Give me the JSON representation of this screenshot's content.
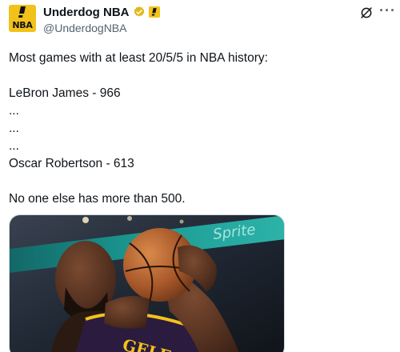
{
  "account": {
    "display_name": "Underdog NBA",
    "handle": "@UnderdogNBA",
    "avatar_text": "NBA",
    "verified_icon": "verified-badge-icon",
    "affiliate_icon": "underdog-affiliate-icon"
  },
  "header_actions": {
    "grok_icon": "grok-icon",
    "more_label": "···"
  },
  "tweet": {
    "lines": [
      "Most games with at least 20/5/5 in NBA history:",
      "",
      "LeBron James - 966",
      "...",
      "...",
      "...",
      "Oscar Robertson - 613",
      "",
      "No one else has more than 500."
    ]
  },
  "media": {
    "alt": "photo-lebron-james-basketball",
    "jersey_text": "GELES",
    "banner_text": "Sprite"
  },
  "colors": {
    "brand_yellow": "#f2c21b",
    "verified_gold": "#e2b719",
    "text_primary": "#0f1419",
    "text_secondary": "#536471"
  }
}
